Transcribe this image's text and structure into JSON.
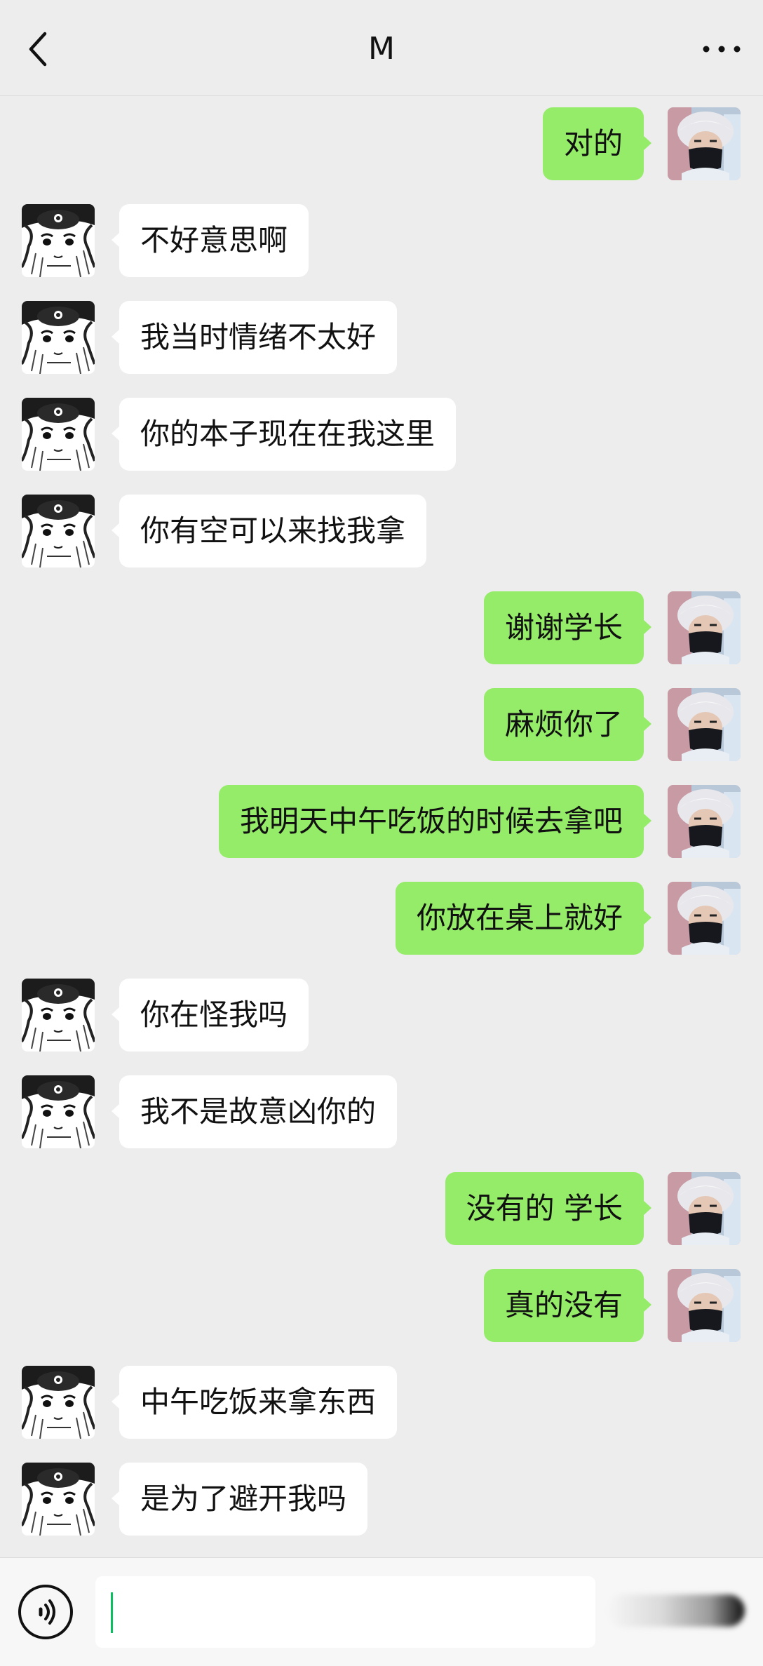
{
  "header": {
    "title": "M"
  },
  "messages": [
    {
      "side": "out",
      "text": "对的"
    },
    {
      "side": "in",
      "text": "不好意思啊"
    },
    {
      "side": "in",
      "text": "我当时情绪不太好"
    },
    {
      "side": "in",
      "text": "你的本子现在在我这里"
    },
    {
      "side": "in",
      "text": "你有空可以来找我拿"
    },
    {
      "side": "out",
      "text": "谢谢学长"
    },
    {
      "side": "out",
      "text": "麻烦你了"
    },
    {
      "side": "out",
      "text": "我明天中午吃饭的时候去拿吧"
    },
    {
      "side": "out",
      "text": "你放在桌上就好"
    },
    {
      "side": "in",
      "text": "你在怪我吗"
    },
    {
      "side": "in",
      "text": "我不是故意凶你的"
    },
    {
      "side": "out",
      "text": "没有的 学长"
    },
    {
      "side": "out",
      "text": "真的没有"
    },
    {
      "side": "in",
      "text": "中午吃饭来拿东西"
    },
    {
      "side": "in",
      "text": "是为了避开我吗"
    }
  ],
  "input": {
    "value": ""
  },
  "icons": {
    "back": "chevron-left-icon",
    "more": "more-dots-icon",
    "voice": "voice-icon"
  },
  "colors": {
    "background": "#ededed",
    "outgoing_bubble": "#95ec69",
    "incoming_bubble": "#ffffff",
    "caret": "#07c160"
  }
}
